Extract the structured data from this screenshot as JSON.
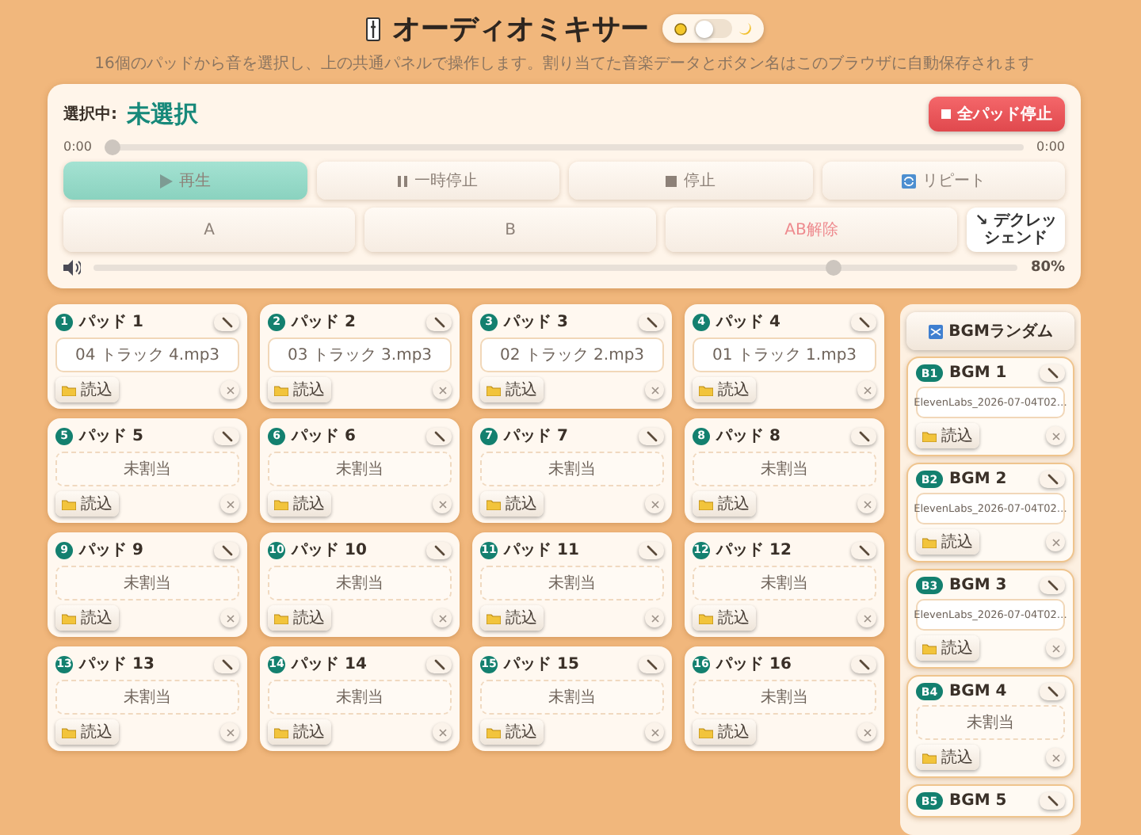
{
  "header": {
    "title": "オーディオミキサー",
    "subtitle": "16個のパッドから音を選択し、上の共通パネルで操作します。割り当てた音楽データとボタン名はこのブラウザに自動保存されます",
    "theme_toggle": {
      "on": false
    }
  },
  "player": {
    "selected_label": "選択中:",
    "selected_value": "未選択",
    "stop_all": "全パッド停止",
    "time_start": "0:00",
    "time_end": "0:00",
    "seek": {
      "level": 0
    },
    "transport": [
      {
        "kind": "play",
        "label": "再生",
        "selected": true
      },
      {
        "kind": "pause",
        "label": "一時停止",
        "selected": false
      },
      {
        "kind": "stop",
        "label": "停止",
        "selected": false
      },
      {
        "kind": "repeat",
        "label": "リピート",
        "selected": false
      }
    ],
    "ab": [
      {
        "kind": "point",
        "label": "A"
      },
      {
        "kind": "point",
        "label": "B"
      },
      {
        "kind": "clear",
        "label": "AB解除"
      },
      {
        "kind": "fade",
        "label": "↘ デクレッシェンド"
      }
    ],
    "volume": {
      "level": 0.8,
      "reading": "80%"
    }
  },
  "pads": [
    {
      "number": "1",
      "name": "パッド 1",
      "file": "04 トラック 4.mp3",
      "assigned": true,
      "load": "読込"
    },
    {
      "number": "2",
      "name": "パッド 2",
      "file": "03 トラック 3.mp3",
      "assigned": true,
      "load": "読込"
    },
    {
      "number": "3",
      "name": "パッド 3",
      "file": "02 トラック 2.mp3",
      "assigned": true,
      "load": "読込"
    },
    {
      "number": "4",
      "name": "パッド 4",
      "file": "01 トラック 1.mp3",
      "assigned": true,
      "load": "読込"
    },
    {
      "number": "5",
      "name": "パッド 5",
      "file": "未割当",
      "assigned": false,
      "load": "読込"
    },
    {
      "number": "6",
      "name": "パッド 6",
      "file": "未割当",
      "assigned": false,
      "load": "読込"
    },
    {
      "number": "7",
      "name": "パッド 7",
      "file": "未割当",
      "assigned": false,
      "load": "読込"
    },
    {
      "number": "8",
      "name": "パッド 8",
      "file": "未割当",
      "assigned": false,
      "load": "読込"
    },
    {
      "number": "9",
      "name": "パッド 9",
      "file": "未割当",
      "assigned": false,
      "load": "読込"
    },
    {
      "number": "10",
      "name": "パッド 10",
      "file": "未割当",
      "assigned": false,
      "load": "読込"
    },
    {
      "number": "11",
      "name": "パッド 11",
      "file": "未割当",
      "assigned": false,
      "load": "読込"
    },
    {
      "number": "12",
      "name": "パッド 12",
      "file": "未割当",
      "assigned": false,
      "load": "読込"
    },
    {
      "number": "13",
      "name": "パッド 13",
      "file": "未割当",
      "assigned": false,
      "load": "読込"
    },
    {
      "number": "14",
      "name": "パッド 14",
      "file": "未割当",
      "assigned": false,
      "load": "読込"
    },
    {
      "number": "15",
      "name": "パッド 15",
      "file": "未割当",
      "assigned": false,
      "load": "読込"
    },
    {
      "number": "16",
      "name": "パッド 16",
      "file": "未割当",
      "assigned": false,
      "load": "読込"
    }
  ],
  "bgm": {
    "title": "BGMランダム",
    "items": [
      {
        "badge": "B1",
        "name": "BGM 1",
        "file": "ElevenLabs_2026-07-04T02…",
        "assigned": true,
        "load": "読込"
      },
      {
        "badge": "B2",
        "name": "BGM 2",
        "file": "ElevenLabs_2026-07-04T02…",
        "assigned": true,
        "load": "読込"
      },
      {
        "badge": "B3",
        "name": "BGM 3",
        "file": "ElevenLabs_2026-07-04T02…",
        "assigned": true,
        "load": "読込"
      },
      {
        "badge": "B4",
        "name": "BGM 4",
        "file": "未割当",
        "assigned": false,
        "load": "読込"
      },
      {
        "badge": "B5",
        "name": "BGM 5"
      }
    ]
  }
}
